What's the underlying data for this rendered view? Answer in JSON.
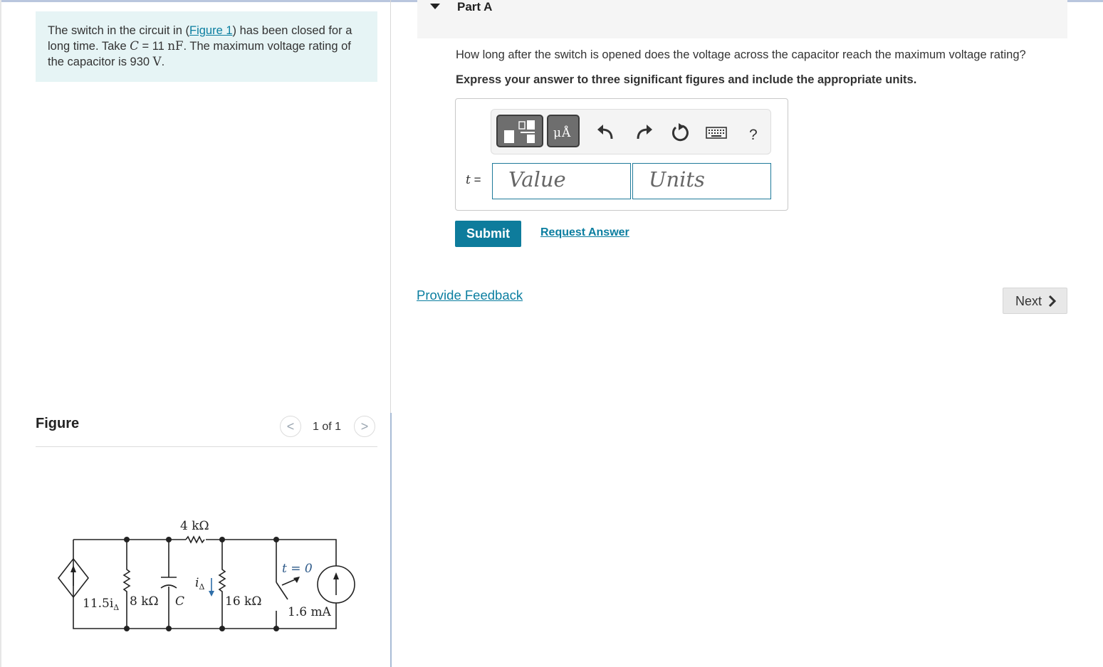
{
  "problem": {
    "text_before_link": "The switch in the circuit in (",
    "figure_link": "Figure 1",
    "text_after_link": ") has been closed for a long time. Take ",
    "c_symbol": "C",
    "c_equals": " = 11 ",
    "c_unit": "nF",
    "text_mid": ". The maximum voltage rating of the capacitor is 930 ",
    "v_unit": "V",
    "text_end": "."
  },
  "figure": {
    "title": "Figure",
    "counter": "1 of 1",
    "prev_glyph": "<",
    "next_glyph": ">",
    "circuit_labels": {
      "r_top": "4 kΩ",
      "source": "11.5i",
      "source_sub": "Δ",
      "r_left": "8 kΩ",
      "cap": "C",
      "current_i": "i",
      "current_sub": "Δ",
      "r_mid": "16 kΩ",
      "switch": "t = 0",
      "current_source": "1.6 mA"
    }
  },
  "part": {
    "title": "Part A",
    "question": "How long after the switch is opened does the voltage across the capacitor reach the maximum voltage rating?",
    "instruction": "Express your answer to three significant figures and include the appropriate units."
  },
  "answer": {
    "variable": "t",
    "equals": "=",
    "value_placeholder": "Value",
    "units_placeholder": "Units"
  },
  "toolbar": {
    "units_glyph": "μÅ",
    "help": "?"
  },
  "buttons": {
    "submit": "Submit",
    "request_answer": "Request Answer",
    "feedback": "Provide Feedback",
    "next": "Next"
  }
}
